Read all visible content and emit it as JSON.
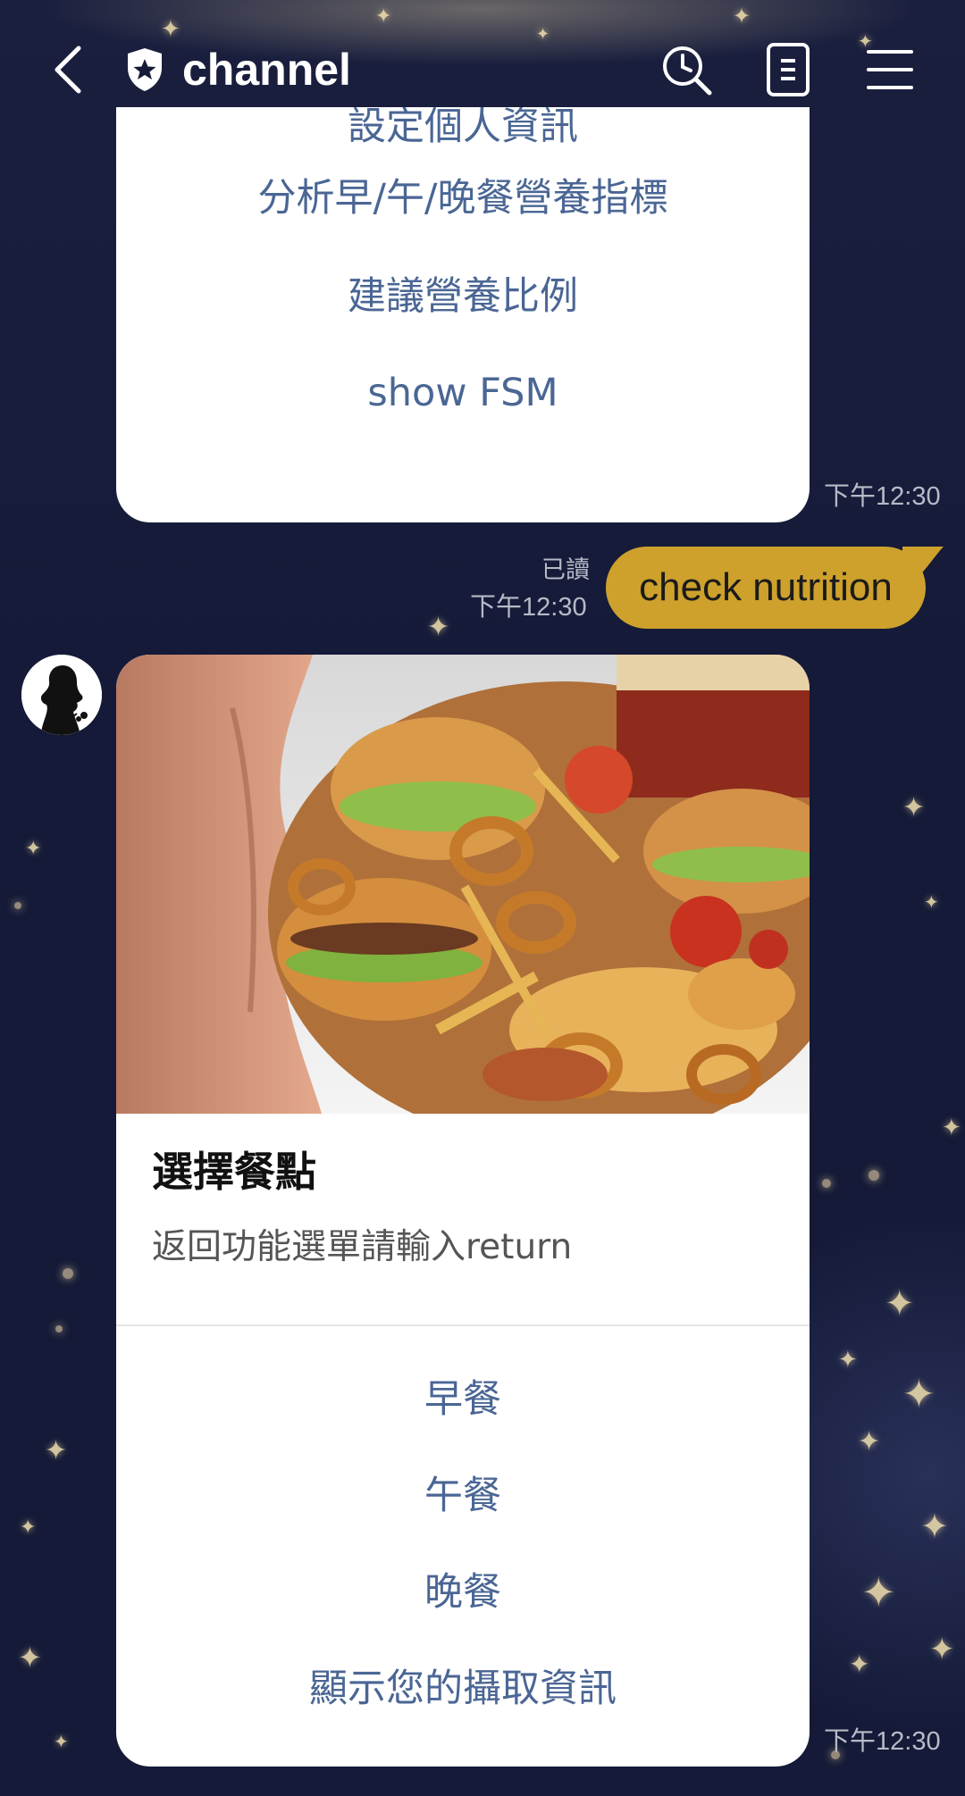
{
  "header": {
    "title": "channel",
    "icons": [
      "back-arrow-icon",
      "shield-star-icon",
      "search-clock-icon",
      "notes-icon",
      "menu-icon"
    ]
  },
  "menu_card": {
    "items": [
      "設定個人資訊",
      "分析早/午/晚餐營養指標",
      "建議營養比例",
      "show FSM"
    ],
    "time": "下午12:30"
  },
  "user_message": {
    "text": "check nutrition",
    "read_label": "已讀",
    "time": "下午12:30"
  },
  "food_card": {
    "title": "選擇餐點",
    "subtitle": "返回功能選單請輸入return",
    "actions": [
      "早餐",
      "午餐",
      "晚餐",
      "顯示您的攝取資訊"
    ],
    "time": "下午12:30"
  },
  "colors": {
    "background": "#141a37",
    "bubble": "#cda12c",
    "link_text": "#4a6694",
    "timestamp": "#b7bac7"
  }
}
